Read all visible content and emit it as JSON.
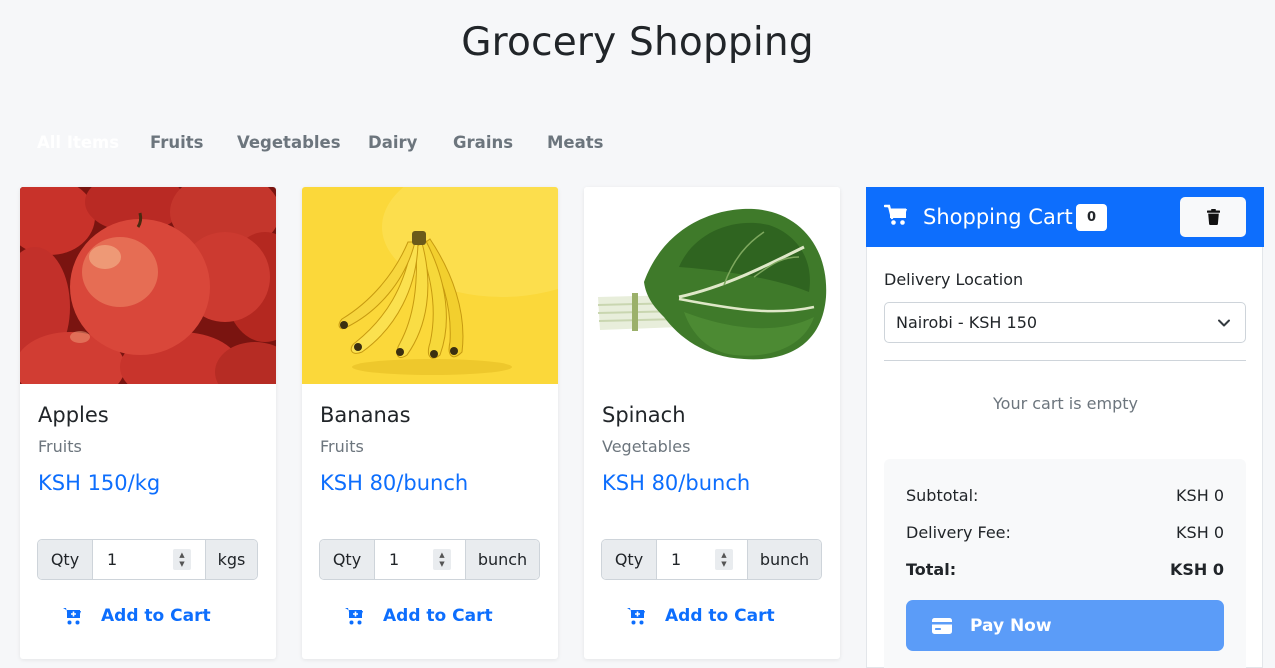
{
  "page": {
    "title": "Grocery Shopping"
  },
  "tabs": [
    {
      "label": "All Items",
      "active": true
    },
    {
      "label": "Fruits",
      "active": false
    },
    {
      "label": "Vegetables",
      "active": false
    },
    {
      "label": "Dairy",
      "active": false
    },
    {
      "label": "Grains",
      "active": false
    },
    {
      "label": "Meats",
      "active": false
    }
  ],
  "products": [
    {
      "name": "Apples",
      "category": "Fruits",
      "price": "KSH 150/kg",
      "qty_label": "Qty",
      "qty_value": "1",
      "unit": "kgs",
      "add_label": "Add to Cart",
      "image": "apples-image"
    },
    {
      "name": "Bananas",
      "category": "Fruits",
      "price": "KSH 80/bunch",
      "qty_label": "Qty",
      "qty_value": "1",
      "unit": "bunch",
      "add_label": "Add to Cart",
      "image": "bananas-image"
    },
    {
      "name": "Spinach",
      "category": "Vegetables",
      "price": "KSH 80/bunch",
      "qty_label": "Qty",
      "qty_value": "1",
      "unit": "bunch",
      "add_label": "Add to Cart",
      "image": "spinach-image"
    }
  ],
  "cart": {
    "title": "Shopping Cart",
    "count": "0",
    "delivery_label": "Delivery Location",
    "delivery_value": "Nairobi - KSH 150",
    "empty_message": "Your cart is empty",
    "subtotal_label": "Subtotal:",
    "subtotal_value": "KSH 0",
    "fee_label": "Delivery Fee:",
    "fee_value": "KSH 0",
    "total_label": "Total:",
    "total_value": "KSH 0",
    "pay_label": "Pay Now"
  },
  "colors": {
    "primary": "#0d6efd",
    "pay_button": "#5b9cf8",
    "background": "#f6f7f9",
    "muted_text": "#6c757d"
  },
  "icons": {
    "cart_header": "shopping-cart-icon",
    "clear_cart": "trash-icon",
    "add_to_cart": "cart-plus-icon",
    "pay": "credit-card-icon",
    "select": "chevron-down-icon"
  }
}
